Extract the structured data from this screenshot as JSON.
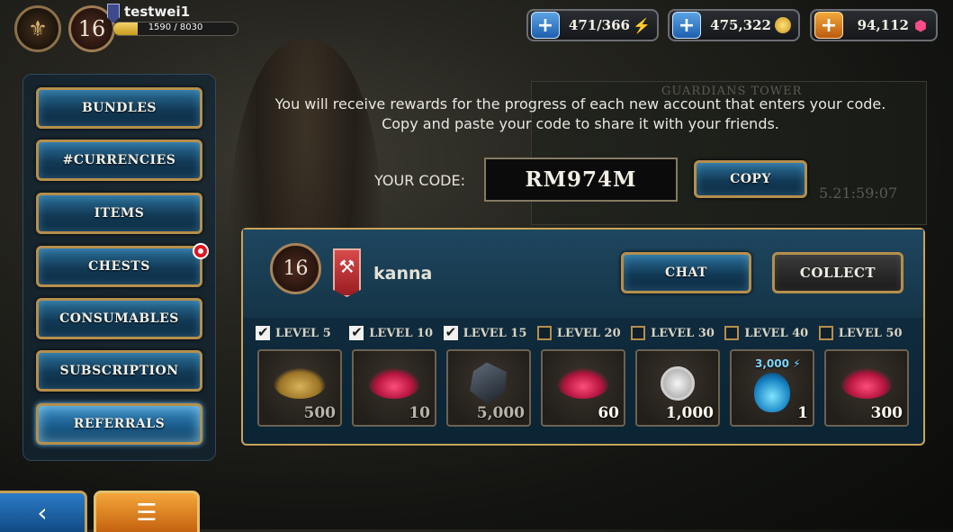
{
  "profile": {
    "username": "testwei1",
    "level": "16",
    "xp_text": "1590 / 8030",
    "xp_fraction": 0.198
  },
  "currencies": [
    {
      "value": "471/366",
      "icon": "energy-bolt-icon",
      "plus_color": "#2f78c8"
    },
    {
      "value": "475,322",
      "icon": "gold-coin-icon",
      "plus_color": "#2f78c8"
    },
    {
      "value": "94,112",
      "icon": "ruby-gem-icon",
      "plus_color": "#e0841f"
    }
  ],
  "menu": {
    "items": [
      {
        "label": "BUNDLES"
      },
      {
        "label": "#CURRENCIES"
      },
      {
        "label": "ITEMS"
      },
      {
        "label": "CHESTS",
        "notification": true
      },
      {
        "label": "CONSUMABLES"
      },
      {
        "label": "SUBSCRIPTION"
      },
      {
        "label": "REFERRALS",
        "active": true
      }
    ]
  },
  "referral": {
    "info_line1": "You will receive rewards for the progress of each new account that enters your code.",
    "info_line2": "Copy and paste your code to share it with your friends.",
    "code_label": "YOUR CODE:",
    "code": "RM974M",
    "copy_label": "COPY",
    "friend": {
      "level": "16",
      "name": "kanna",
      "chat_label": "CHAT",
      "collect_label": "COLLECT"
    },
    "levels": [
      {
        "label": "LEVEL 5",
        "checked": true
      },
      {
        "label": "LEVEL 10",
        "checked": true
      },
      {
        "label": "LEVEL 15",
        "checked": true
      },
      {
        "label": "LEVEL 20",
        "checked": false
      },
      {
        "label": "LEVEL 30",
        "checked": false
      },
      {
        "label": "LEVEL 40",
        "checked": false
      },
      {
        "label": "LEVEL 50",
        "checked": false
      }
    ],
    "rewards": [
      {
        "qty": "500",
        "icon": "gold-pile-icon"
      },
      {
        "qty": "10",
        "icon": "ruby-pile-icon"
      },
      {
        "qty": "5,000",
        "icon": "dark-stone-icon"
      },
      {
        "qty": "60",
        "icon": "ruby-pile-icon"
      },
      {
        "qty": "1,000",
        "icon": "silver-medal-icon"
      },
      {
        "qty": "1",
        "icon": "energy-potion-icon",
        "extra": "3,000"
      },
      {
        "qty": "300",
        "icon": "ruby-pile-icon"
      }
    ]
  },
  "background": {
    "tower_title": "GUARDIANS TOWER",
    "tower_timer": "5.21:59:07"
  },
  "colors": {
    "accent_gold": "#b58f4c",
    "button_blue": "#1b5e8e"
  }
}
